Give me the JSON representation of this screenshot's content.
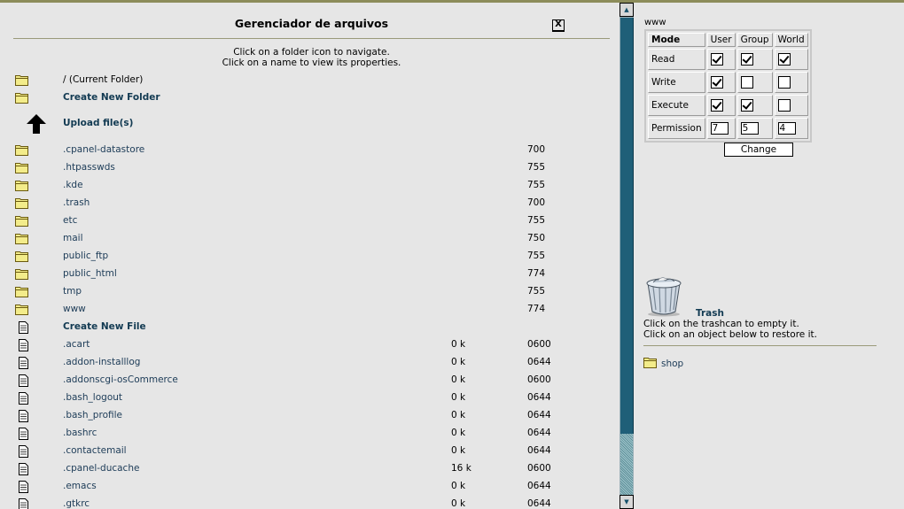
{
  "title": "Gerenciador de arquivos",
  "close_label": "X",
  "instructions": [
    "Click on a folder icon to navigate.",
    "Click on a name to view its properties."
  ],
  "current_folder": "/ (Current Folder)",
  "create_folder": "Create New Folder",
  "upload": "Upload file(s)",
  "folders": [
    {
      "name": ".cpanel-datastore",
      "perm": "700"
    },
    {
      "name": ".htpasswds",
      "perm": "755"
    },
    {
      "name": ".kde",
      "perm": "755"
    },
    {
      "name": ".trash",
      "perm": "700"
    },
    {
      "name": "etc",
      "perm": "755"
    },
    {
      "name": "mail",
      "perm": "750"
    },
    {
      "name": "public_ftp",
      "perm": "755"
    },
    {
      "name": "public_html",
      "perm": "774"
    },
    {
      "name": "tmp",
      "perm": "755"
    },
    {
      "name": "www",
      "perm": "774"
    }
  ],
  "create_file": "Create New File",
  "files": [
    {
      "name": ".acart",
      "size": "0 k",
      "perm": "0600"
    },
    {
      "name": ".addon-installlog",
      "size": "0 k",
      "perm": "0644"
    },
    {
      "name": ".addonscgi-osCommerce",
      "size": "0 k",
      "perm": "0600"
    },
    {
      "name": ".bash_logout",
      "size": "0 k",
      "perm": "0644"
    },
    {
      "name": ".bash_profile",
      "size": "0 k",
      "perm": "0644"
    },
    {
      "name": ".bashrc",
      "size": "0 k",
      "perm": "0644"
    },
    {
      "name": ".contactemail",
      "size": "0 k",
      "perm": "0644"
    },
    {
      "name": ".cpanel-ducache",
      "size": "16 k",
      "perm": "0600"
    },
    {
      "name": ".emacs",
      "size": "0 k",
      "perm": "0644"
    },
    {
      "name": ".gtkrc",
      "size": "0 k",
      "perm": "0644"
    }
  ],
  "permissions": {
    "target": "www",
    "headers": [
      "Mode",
      "User",
      "Group",
      "World"
    ],
    "rows": [
      {
        "label": "Read",
        "checks": [
          true,
          true,
          true
        ]
      },
      {
        "label": "Write",
        "checks": [
          true,
          false,
          false
        ]
      },
      {
        "label": "Execute",
        "checks": [
          true,
          true,
          false
        ]
      }
    ],
    "perm_label": "Permission",
    "values": [
      "7",
      "5",
      "4"
    ],
    "change_label": "Change"
  },
  "trash": {
    "label": "Trash",
    "lines": [
      "Click on the trashcan to empty it.",
      "Click on an object below to restore it."
    ],
    "items": [
      "shop"
    ]
  },
  "colors": {
    "link": "#1c3b57",
    "scroll_thumb": "#1f5f78",
    "folder": "#f3ec8a"
  },
  "icons": {
    "folder": "folder-icon",
    "file": "file-icon",
    "upload": "up-arrow-icon",
    "trash": "trashcan-icon"
  }
}
